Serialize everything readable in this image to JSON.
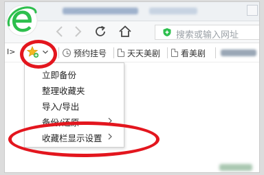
{
  "app": {
    "logo_icon": "ie-logo-icon",
    "accent": "#2dbf4d"
  },
  "toolbar": {
    "back_icon": "chevron-left-icon",
    "forward_icon": "chevron-right-icon",
    "refresh_icon": "refresh-icon",
    "home_icon": "home-icon",
    "address_placeholder": "搜索或输入网址",
    "address_icon": "shield-icon"
  },
  "bookmarks_bar": {
    "edge_label": "I>",
    "favorites_icon": "star-add-icon",
    "items": [
      {
        "label": "预约挂号",
        "icon": "clock-icon"
      },
      {
        "label": "天天美剧",
        "icon": "page-icon"
      },
      {
        "label": "看美剧",
        "icon": "page-icon"
      }
    ]
  },
  "menu": {
    "items": [
      {
        "label": "立即备份",
        "has_submenu": false
      },
      {
        "label": "整理收藏夹",
        "has_submenu": false
      },
      {
        "label": "导入/导出",
        "has_submenu": false
      },
      {
        "label": "备份/还原",
        "has_submenu": true
      },
      {
        "label": "收藏栏显示设置",
        "has_submenu": true
      }
    ]
  },
  "annotation_color": "#e3161e"
}
